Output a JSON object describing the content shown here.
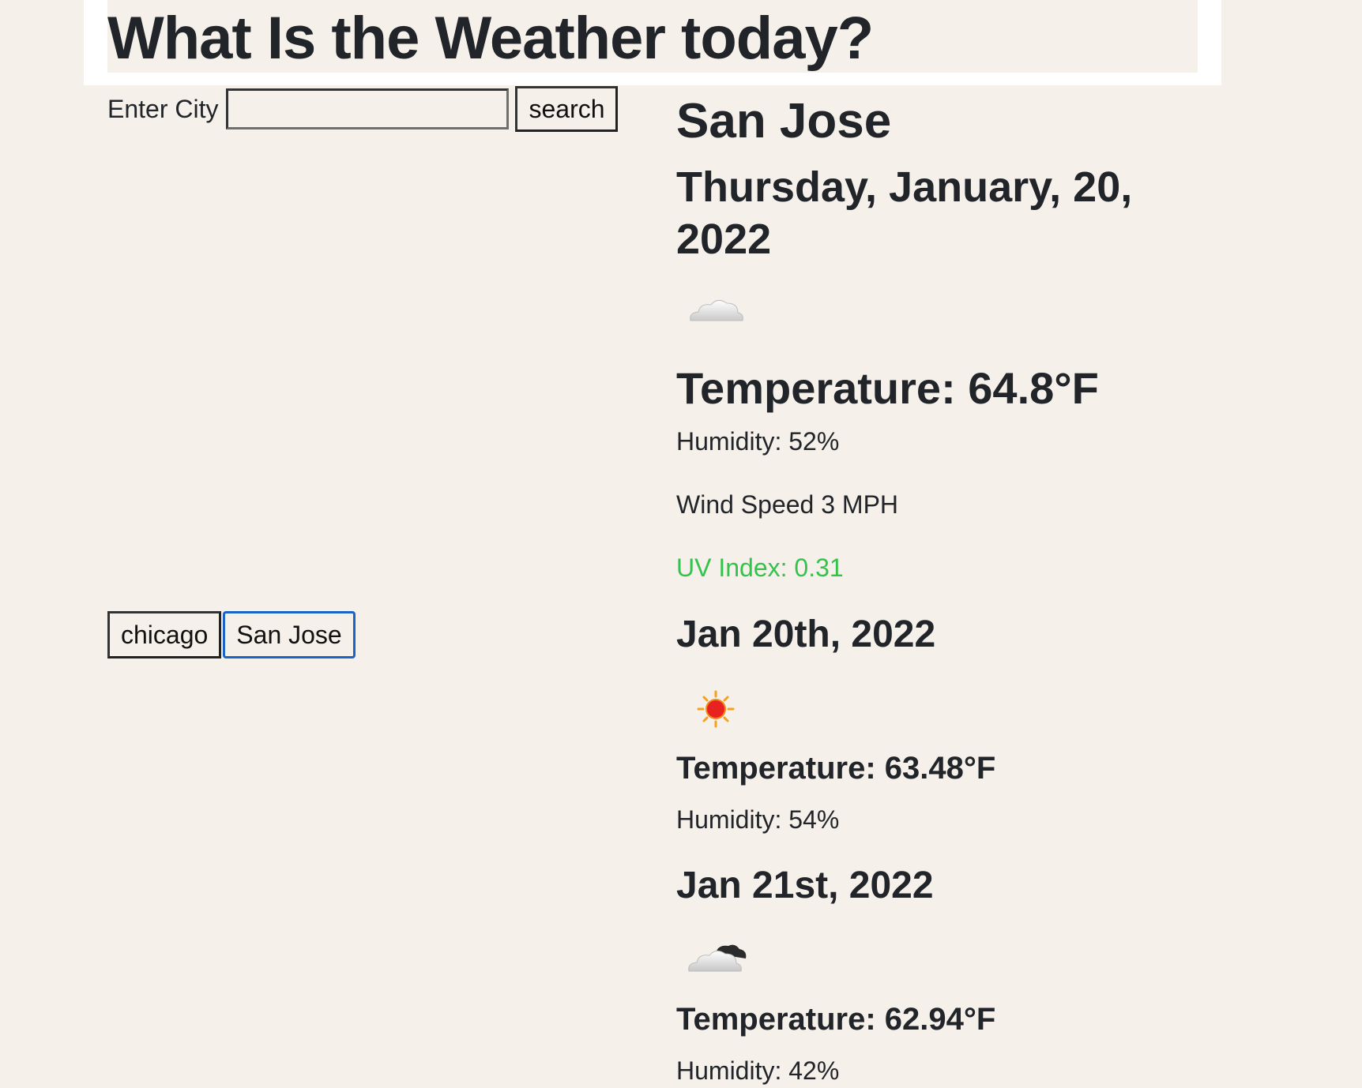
{
  "header": {
    "title": "What Is the Weather today?"
  },
  "search": {
    "label": "Enter City",
    "value": "",
    "placeholder": "",
    "button_label": "search"
  },
  "history": [
    {
      "label": "chicago",
      "active": false
    },
    {
      "label": "San Jose",
      "active": true
    }
  ],
  "current": {
    "city": "San Jose",
    "date": "Thursday, January, 20, 2022",
    "icon": "cloud-icon",
    "temperature": "Temperature: 64.8°F",
    "humidity": "Humidity: 52%",
    "wind": "Wind Speed 3 MPH",
    "uv": "UV Index: 0.31",
    "uv_color": "#33c34a"
  },
  "forecast": [
    {
      "date": "Jan 20th, 2022",
      "icon": "sun-icon",
      "temperature": "Temperature: 63.48°F",
      "humidity": "Humidity: 54%"
    },
    {
      "date": "Jan 21st, 2022",
      "icon": "partly-cloudy-icon",
      "temperature": "Temperature: 62.94°F",
      "humidity": "Humidity: 42%"
    }
  ],
  "colors": {
    "background": "#f6f0ea",
    "header_band": "#ffffff",
    "active_button_border": "#1a64c8"
  }
}
